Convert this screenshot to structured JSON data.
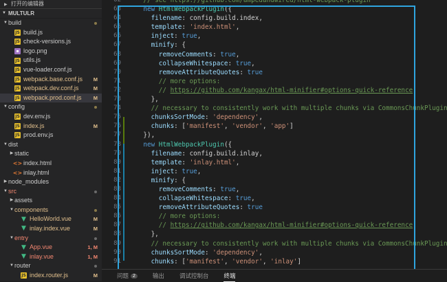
{
  "sidebar": {
    "open_editors_label": "打开的编辑器",
    "section_title": "MULTULR",
    "items": [
      {
        "indent": 0,
        "type": "folder",
        "open": true,
        "name": "build",
        "label_class": "folder",
        "status": "dot-mod"
      },
      {
        "indent": 1,
        "type": "js",
        "name": "build.js"
      },
      {
        "indent": 1,
        "type": "js",
        "name": "check-versions.js"
      },
      {
        "indent": 1,
        "type": "img",
        "name": "logo.png"
      },
      {
        "indent": 1,
        "type": "js",
        "name": "utils.js"
      },
      {
        "indent": 1,
        "type": "js",
        "name": "vue-loader.conf.js"
      },
      {
        "indent": 1,
        "type": "js",
        "name": "webpack.base.conf.js",
        "label_class": "mod",
        "badge": "M"
      },
      {
        "indent": 1,
        "type": "js",
        "name": "webpack.dev.conf.js",
        "label_class": "mod",
        "badge": "M"
      },
      {
        "indent": 1,
        "type": "js",
        "name": "webpack.prod.conf.js",
        "label_class": "mod",
        "badge": "M",
        "selected": true
      },
      {
        "indent": 0,
        "type": "folder",
        "open": true,
        "name": "config",
        "status": "dot-mod"
      },
      {
        "indent": 1,
        "type": "js",
        "name": "dev.env.js"
      },
      {
        "indent": 1,
        "type": "js",
        "name": "index.js",
        "label_class": "mod",
        "badge": "M"
      },
      {
        "indent": 1,
        "type": "js",
        "name": "prod.env.js"
      },
      {
        "indent": 0,
        "type": "folder",
        "open": true,
        "name": "dist"
      },
      {
        "indent": 1,
        "type": "folder",
        "open": false,
        "name": "static"
      },
      {
        "indent": 1,
        "type": "html",
        "name": "index.html"
      },
      {
        "indent": 1,
        "type": "html",
        "name": "inlay.html"
      },
      {
        "indent": 0,
        "type": "folder",
        "open": false,
        "name": "node_modules"
      },
      {
        "indent": 0,
        "type": "folder",
        "open": true,
        "name": "src",
        "label_class": "err",
        "status": "dot"
      },
      {
        "indent": 1,
        "type": "folder",
        "open": false,
        "name": "assets"
      },
      {
        "indent": 1,
        "type": "folder",
        "open": true,
        "name": "components",
        "label_class": "mod",
        "status": "dot-mod"
      },
      {
        "indent": 2,
        "type": "vue",
        "name": "HelloWorld.vue",
        "label_class": "mod",
        "badge": "M"
      },
      {
        "indent": 2,
        "type": "vue",
        "name": "inlay.index.vue",
        "label_class": "mod",
        "badge": "M"
      },
      {
        "indent": 1,
        "type": "folder",
        "open": true,
        "name": "entry",
        "label_class": "err",
        "status": "dot"
      },
      {
        "indent": 2,
        "type": "vue",
        "name": "App.vue",
        "label_class": "err",
        "badge": "1, M",
        "badge_class": "err"
      },
      {
        "indent": 2,
        "type": "vue",
        "name": "inlay.vue",
        "label_class": "err",
        "badge": "1, M",
        "badge_class": "err"
      },
      {
        "indent": 1,
        "type": "folder",
        "open": true,
        "name": "router",
        "status": "dot"
      },
      {
        "indent": 2,
        "type": "js",
        "name": "index.router.js",
        "label_class": "mod",
        "badge": "M"
      }
    ]
  },
  "editor": {
    "line_numbers": [
      "62",
      "63",
      "64",
      "65",
      "66",
      "67",
      "68",
      "69",
      "70",
      "71",
      "72",
      "73",
      "74",
      "75",
      "76",
      "77",
      "78",
      "79",
      "80",
      "81",
      "82",
      "83",
      "84",
      "85",
      "86",
      "87",
      "88",
      "89",
      "90",
      "91"
    ],
    "lines": [
      [
        [
          "com",
          "    // see https://github.com/ampedandwired/html-webpack-plugin"
        ]
      ],
      [
        [
          "kw",
          "    new "
        ],
        [
          "cls",
          "HtmlWebpackPlugin"
        ],
        [
          "",
          "({"
        ]
      ],
      [
        [
          "prop",
          "      filename"
        ],
        [
          "",
          ": config.build.index,"
        ]
      ],
      [
        [
          "prop",
          "      template"
        ],
        [
          "",
          ": "
        ],
        [
          "str",
          "'index.html'"
        ],
        [
          "",
          ","
        ]
      ],
      [
        [
          "prop",
          "      inject"
        ],
        [
          "",
          ": "
        ],
        [
          "bool",
          "true"
        ],
        [
          "",
          ","
        ]
      ],
      [
        [
          "prop",
          "      minify"
        ],
        [
          "",
          ": {"
        ]
      ],
      [
        [
          "prop",
          "        removeComments"
        ],
        [
          "",
          ": "
        ],
        [
          "bool",
          "true"
        ],
        [
          "",
          ","
        ]
      ],
      [
        [
          "prop",
          "        collapseWhitespace"
        ],
        [
          "",
          ": "
        ],
        [
          "bool",
          "true"
        ],
        [
          "",
          ","
        ]
      ],
      [
        [
          "prop",
          "        removeAttributeQuotes"
        ],
        [
          "",
          ": "
        ],
        [
          "bool",
          "true"
        ]
      ],
      [
        [
          "com",
          "        // more options:"
        ]
      ],
      [
        [
          "com",
          "        // "
        ],
        [
          "lnk",
          "https://github.com/kangax/html-minifier#options-quick-reference"
        ]
      ],
      [
        [
          "",
          "      },"
        ]
      ],
      [
        [
          "com",
          "      // necessary to consistently work with multiple chunks via CommonsChunkPlugin"
        ]
      ],
      [
        [
          "prop",
          "      chunksSortMode"
        ],
        [
          "",
          ": "
        ],
        [
          "str",
          "'dependency'"
        ],
        [
          "",
          ","
        ]
      ],
      [
        [
          "prop",
          "      chunks"
        ],
        [
          "",
          ": ["
        ],
        [
          "str",
          "'manifest'"
        ],
        [
          "",
          ", "
        ],
        [
          "str",
          "'vendor'"
        ],
        [
          "",
          ", "
        ],
        [
          "str",
          "'app'"
        ],
        [
          "",
          "]"
        ]
      ],
      [
        [
          "",
          "    }),"
        ]
      ],
      [
        [
          "kw",
          "    new "
        ],
        [
          "cls",
          "HtmlWebpackPlugin"
        ],
        [
          "",
          "({"
        ]
      ],
      [
        [
          "prop",
          "      filename"
        ],
        [
          "",
          ": config.build.inlay,"
        ]
      ],
      [
        [
          "prop",
          "      template"
        ],
        [
          "",
          ": "
        ],
        [
          "str",
          "'inlay.html'"
        ],
        [
          "",
          ","
        ]
      ],
      [
        [
          "prop",
          "      inject"
        ],
        [
          "",
          ": "
        ],
        [
          "bool",
          "true"
        ],
        [
          "",
          ","
        ]
      ],
      [
        [
          "prop",
          "      minify"
        ],
        [
          "",
          ": {"
        ]
      ],
      [
        [
          "prop",
          "        removeComments"
        ],
        [
          "",
          ": "
        ],
        [
          "bool",
          "true"
        ],
        [
          "",
          ","
        ]
      ],
      [
        [
          "prop",
          "        collapseWhitespace"
        ],
        [
          "",
          ": "
        ],
        [
          "bool",
          "true"
        ],
        [
          "",
          ","
        ]
      ],
      [
        [
          "prop",
          "        removeAttributeQuotes"
        ],
        [
          "",
          ": "
        ],
        [
          "bool",
          "true"
        ]
      ],
      [
        [
          "com",
          "        // more options:"
        ]
      ],
      [
        [
          "com",
          "        // "
        ],
        [
          "lnk",
          "https://github.com/kangax/html-minifier#options-quick-reference"
        ]
      ],
      [
        [
          "",
          "      },"
        ]
      ],
      [
        [
          "com",
          "      // necessary to consistently work with multiple chunks via CommonsChunkPlugin"
        ]
      ],
      [
        [
          "prop",
          "      chunksSortMode"
        ],
        [
          "",
          ": "
        ],
        [
          "str",
          "'dependency'"
        ],
        [
          "",
          ","
        ]
      ],
      [
        [
          "prop",
          "      chunks"
        ],
        [
          "",
          ": ["
        ],
        [
          "str",
          "'manifest'"
        ],
        [
          "",
          ", "
        ],
        [
          "str",
          "'vendor'"
        ],
        [
          "",
          ", "
        ],
        [
          "str",
          "'inlay'"
        ],
        [
          "",
          "]"
        ]
      ]
    ]
  },
  "panel": {
    "tabs": [
      {
        "label": "问题",
        "count": "2"
      },
      {
        "label": "输出"
      },
      {
        "label": "调试控制台"
      },
      {
        "label": "终端",
        "active": true
      }
    ]
  },
  "colors": {
    "highlight_border": "#2fa6e0",
    "modified": "#e2c08d",
    "error": "#f48771"
  }
}
